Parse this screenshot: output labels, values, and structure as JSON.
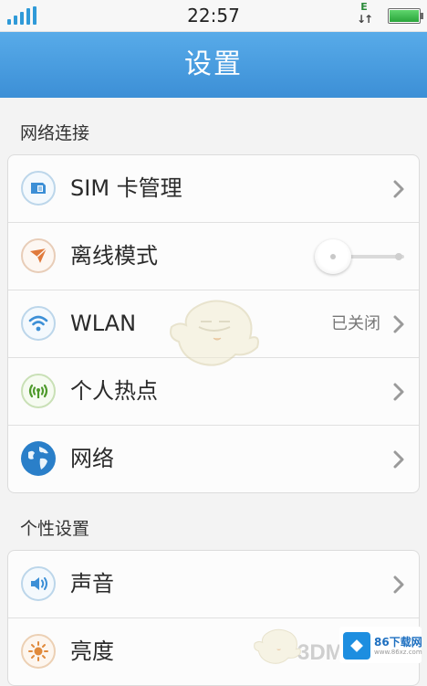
{
  "status_bar": {
    "time": "22:57",
    "network_type": "E",
    "network_arrows": "↓↑",
    "icons": [
      "signal-bars-icon",
      "data-arrows-icon",
      "battery-icon"
    ]
  },
  "header": {
    "title": "设置"
  },
  "sections": [
    {
      "label": "网络连接",
      "items": [
        {
          "label": "SIM 卡管理",
          "icon": "sim-card-icon"
        },
        {
          "label": "离线模式",
          "icon": "paper-plane-icon",
          "toggle_on": false
        },
        {
          "label": "WLAN",
          "icon": "wifi-icon",
          "value": "已关闭"
        },
        {
          "label": "个人热点",
          "icon": "hotspot-icon"
        },
        {
          "label": "网络",
          "icon": "globe-icon"
        }
      ]
    },
    {
      "label": "个性设置",
      "items": [
        {
          "label": "声音",
          "icon": "speaker-icon"
        },
        {
          "label": "亮度",
          "icon": "sun-icon"
        }
      ]
    }
  ],
  "watermarks": {
    "site_text": "3DM",
    "logo_title": "86下载网",
    "logo_subtitle": "www.86xz.com"
  },
  "colors": {
    "header_blue": "#4a9de2",
    "signal_blue": "#2f9ad8",
    "battery_green": "#3bbf4a"
  }
}
